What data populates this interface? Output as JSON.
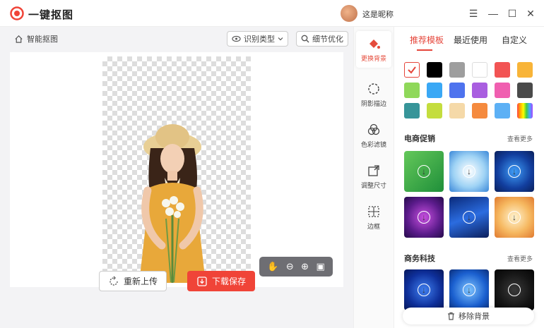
{
  "app": {
    "title": "一键抠图",
    "user_name": "这是昵称"
  },
  "window": {
    "menu_icon": "menu-icon",
    "min_icon": "minimize-icon",
    "max_icon": "maximize-icon",
    "close_icon": "close-icon"
  },
  "toolbar": {
    "breadcrumb": "智能抠图",
    "recognize_type": "识别类型",
    "detail_optimize": "细节优化"
  },
  "actions": {
    "reupload": "重新上传",
    "download": "下载保存"
  },
  "rail": [
    {
      "label": "更换背景",
      "icon": "paint-bucket-icon"
    },
    {
      "label": "阴影描边",
      "icon": "shadow-icon"
    },
    {
      "label": "色彩滤镜",
      "icon": "color-filter-icon"
    },
    {
      "label": "调整尺寸",
      "icon": "resize-icon"
    },
    {
      "label": "边框",
      "icon": "border-icon"
    }
  ],
  "tabs": [
    "推荐模板",
    "最近使用",
    "自定义"
  ],
  "colors": {
    "accent": "#e5453a",
    "swatches": [
      "#ffffff",
      "#000000",
      "#9e9e9e",
      "#ffffff",
      "#f25454",
      "#f8b438",
      "#8fd85a",
      "#3aa8f5",
      "#4e73ee",
      "#a95ee0",
      "#f05fb0",
      "#4a4a4a",
      "#379599",
      "#c4dd3e",
      "#f5d9a8",
      "#f58a3e",
      "#5cb0f5",
      "rainbow"
    ]
  },
  "sections": [
    {
      "title": "电商促销",
      "more": "查看更多"
    },
    {
      "title": "商务科技",
      "more": "查看更多"
    }
  ],
  "remove_bg": "移除背景"
}
